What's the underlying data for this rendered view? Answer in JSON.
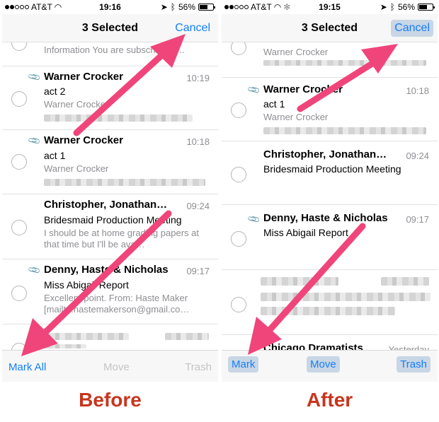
{
  "before": {
    "status": {
      "carrier": "AT&T",
      "time": "19:16",
      "battery": "56%"
    },
    "nav": {
      "title": "3 Selected",
      "cancel": "Cancel"
    },
    "top_preview": "Information You are subscribed t…",
    "messages": [
      {
        "sender": "Warner Crocker",
        "time": "10:19",
        "subject": "act 2",
        "preview": "Warner Crocker"
      },
      {
        "sender": "Warner Crocker",
        "time": "10:18",
        "subject": "act 1",
        "preview": "Warner Crocker"
      },
      {
        "sender": "Christopher, Jonathan…",
        "time": "09:24",
        "subject": "Bridesmaid Production Meeting",
        "preview": "I should be at home grading papers at that time but I'll be ava…"
      },
      {
        "sender": "Denny, Haste & Nicholas",
        "time": "09:17",
        "subject": "Miss Abigail Report",
        "preview": "Excellent point. From: Haste Maker [mailto:hastemakerson@gmail.co…"
      }
    ],
    "toolbar": {
      "mark": "Mark All",
      "move": "Move",
      "trash": "Trash"
    },
    "caption": "Before"
  },
  "after": {
    "status": {
      "carrier": "AT&T",
      "time": "19:15",
      "battery": "56%"
    },
    "nav": {
      "title": "3 Selected",
      "cancel": "Cancel"
    },
    "top_preview": "Warner Crocker",
    "messages": [
      {
        "sender": "Warner Crocker",
        "time": "10:18",
        "subject": "act 1",
        "preview": "Warner Crocker"
      },
      {
        "sender": "Christopher, Jonathan…",
        "time": "09:24",
        "subject": "Bridesmaid Production Meeting"
      },
      {
        "sender": "Denny, Haste & Nicholas",
        "time": "09:17",
        "subject": "Miss Abigail Report"
      },
      {
        "sender": "Chicago Dramatists",
        "time": "Yesterday"
      }
    ],
    "toolbar": {
      "mark": "Mark",
      "move": "Move",
      "trash": "Trash"
    },
    "caption": "After"
  },
  "colors": {
    "accent": "#147efb",
    "arrow": "#f0457a",
    "caption": "#c8351d"
  }
}
